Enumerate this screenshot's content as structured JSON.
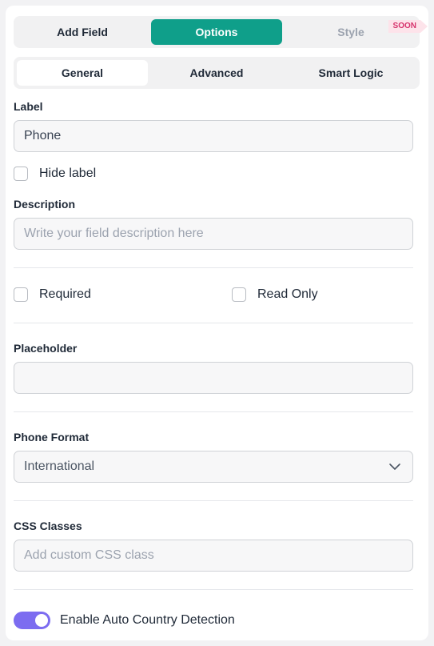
{
  "top_tabs": {
    "add_field": "Add Field",
    "options": "Options",
    "style": "Style",
    "soon_badge": "SOON"
  },
  "sub_tabs": {
    "general": "General",
    "advanced": "Advanced",
    "smart_logic": "Smart Logic"
  },
  "label_section": {
    "title": "Label",
    "value": "Phone",
    "hide_label": "Hide label",
    "hide_label_checked": false
  },
  "description_section": {
    "title": "Description",
    "placeholder": "Write your field description here"
  },
  "flags": {
    "required": "Required",
    "read_only": "Read Only"
  },
  "placeholder_section": {
    "title": "Placeholder",
    "value": ""
  },
  "phone_format": {
    "title": "Phone Format",
    "selected": "International"
  },
  "css_classes": {
    "title": "CSS Classes",
    "placeholder": "Add custom CSS class"
  },
  "auto_country": {
    "label": "Enable Auto Country Detection",
    "enabled": true
  },
  "colors": {
    "accent": "#0f9f8a",
    "toggle": "#7c6cf0",
    "soon_text": "#d6336c"
  }
}
